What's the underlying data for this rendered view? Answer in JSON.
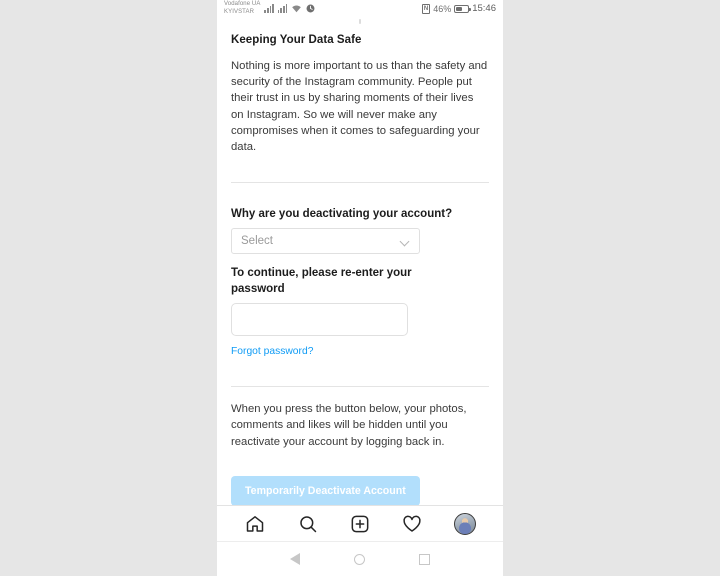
{
  "status_bar": {
    "carrier_line1": "Vodafone UA",
    "carrier_line2": "KYIVSTAR",
    "nfc_label": "N",
    "battery_percent": "46%",
    "clock": "15:46"
  },
  "page": {
    "section_title": "Keeping Your Data Safe",
    "body_paragraph": "Nothing is more important to us than the safety and security of the Instagram community. People put their trust in us by sharing moments of their lives on Instagram. So we will never make any compromises when it comes to safeguarding your data.",
    "reason_label": "Why are you deactivating your account?",
    "reason_select_value": "Select",
    "password_label": "To continue, please re-enter your password",
    "password_value": "",
    "password_placeholder": "",
    "forgot_password_link": "Forgot password?",
    "note_paragraph": "When you press the button below, your photos, comments and likes will be hidden until you reactivate your account by logging back in.",
    "deactivate_button": "Temporarily Deactivate Account"
  },
  "colors": {
    "link_blue": "#0f9bf5",
    "button_blue": "#b2dffc",
    "text_primary": "#1c1c1c",
    "text_body": "#3a3a3a",
    "divider": "#e4e4e4",
    "page_background": "#e6e6e6"
  },
  "tab_bar": {
    "items": [
      {
        "name": "home",
        "label": "Home"
      },
      {
        "name": "search",
        "label": "Search"
      },
      {
        "name": "add",
        "label": "New Post"
      },
      {
        "name": "activity",
        "label": "Activity"
      },
      {
        "name": "profile",
        "label": "Profile"
      }
    ]
  },
  "nav_bar": {
    "back": "Back",
    "home": "Home",
    "recents": "Recents"
  }
}
